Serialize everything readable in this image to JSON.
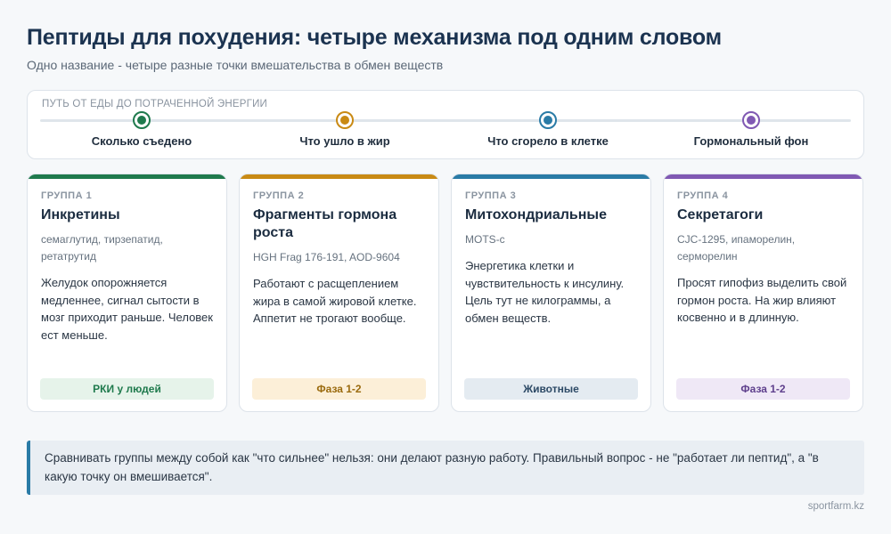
{
  "header": {
    "title": "Пептиды для похудения: четыре механизма под одним словом",
    "subtitle": "Одно название - четыре разные точки вмешательства в обмен веществ"
  },
  "timeline": {
    "caption": "ПУТЬ ОТ ЕДЫ ДО ПОТРАЧЕННОЙ ЭНЕРГИИ",
    "steps": [
      {
        "label": "Сколько съедено",
        "color": "#1f7a4d"
      },
      {
        "label": "Что ушло в жир",
        "color": "#c98a14"
      },
      {
        "label": "Что сгорело в клетке",
        "color": "#2a7ba6"
      },
      {
        "label": "Гормональный фон",
        "color": "#8059b3"
      }
    ]
  },
  "cards": [
    {
      "group": "ГРУППА 1",
      "title": "Инкретины",
      "examples": "семаглутид, тирзепатид, ретатрутид",
      "description": "Желудок опорожняется медленнее, сигнал сытости в мозг приходит раньше. Человек ест меньше.",
      "badge": "РКИ у людей",
      "accent": "#1f7a4d",
      "badge_bg": "#e6f3ea",
      "badge_color": "#1f7a4d"
    },
    {
      "group": "ГРУППА 2",
      "title": "Фрагменты гормона роста",
      "examples": "HGH Frag 176-191, AOD-9604",
      "description": "Работают с расщеплением жира в самой жировой клетке. Аппетит не трогают вообще.",
      "badge": "Фаза 1-2",
      "accent": "#c98a14",
      "badge_bg": "#fcefd8",
      "badge_color": "#9a6a0e"
    },
    {
      "group": "ГРУППА 3",
      "title": "Митохондриальные",
      "examples": "MOTS-c",
      "description": "Энергетика клетки и чувствительность к инсулину. Цель тут не килограммы, а обмен веществ.",
      "badge": "Животные",
      "accent": "#2a7ba6",
      "badge_bg": "#e4ebf1",
      "badge_color": "#2d4a66"
    },
    {
      "group": "ГРУППА 4",
      "title": "Секретагоги",
      "examples": "CJC-1295, ипаморелин, серморелин",
      "description": "Просят гипофиз выделить свой гормон роста. На жир влияют косвенно и в длинную.",
      "badge": "Фаза 1-2",
      "accent": "#8059b3",
      "badge_bg": "#efe8f6",
      "badge_color": "#5e3f8c"
    }
  ],
  "note": "Сравнивать группы между собой как \"что сильнее\" нельзя: они делают разную работу. Правильный вопрос - не \"работает ли пептид\", а \"в какую точку он вмешивается\".",
  "source": "sportfarm.kz"
}
